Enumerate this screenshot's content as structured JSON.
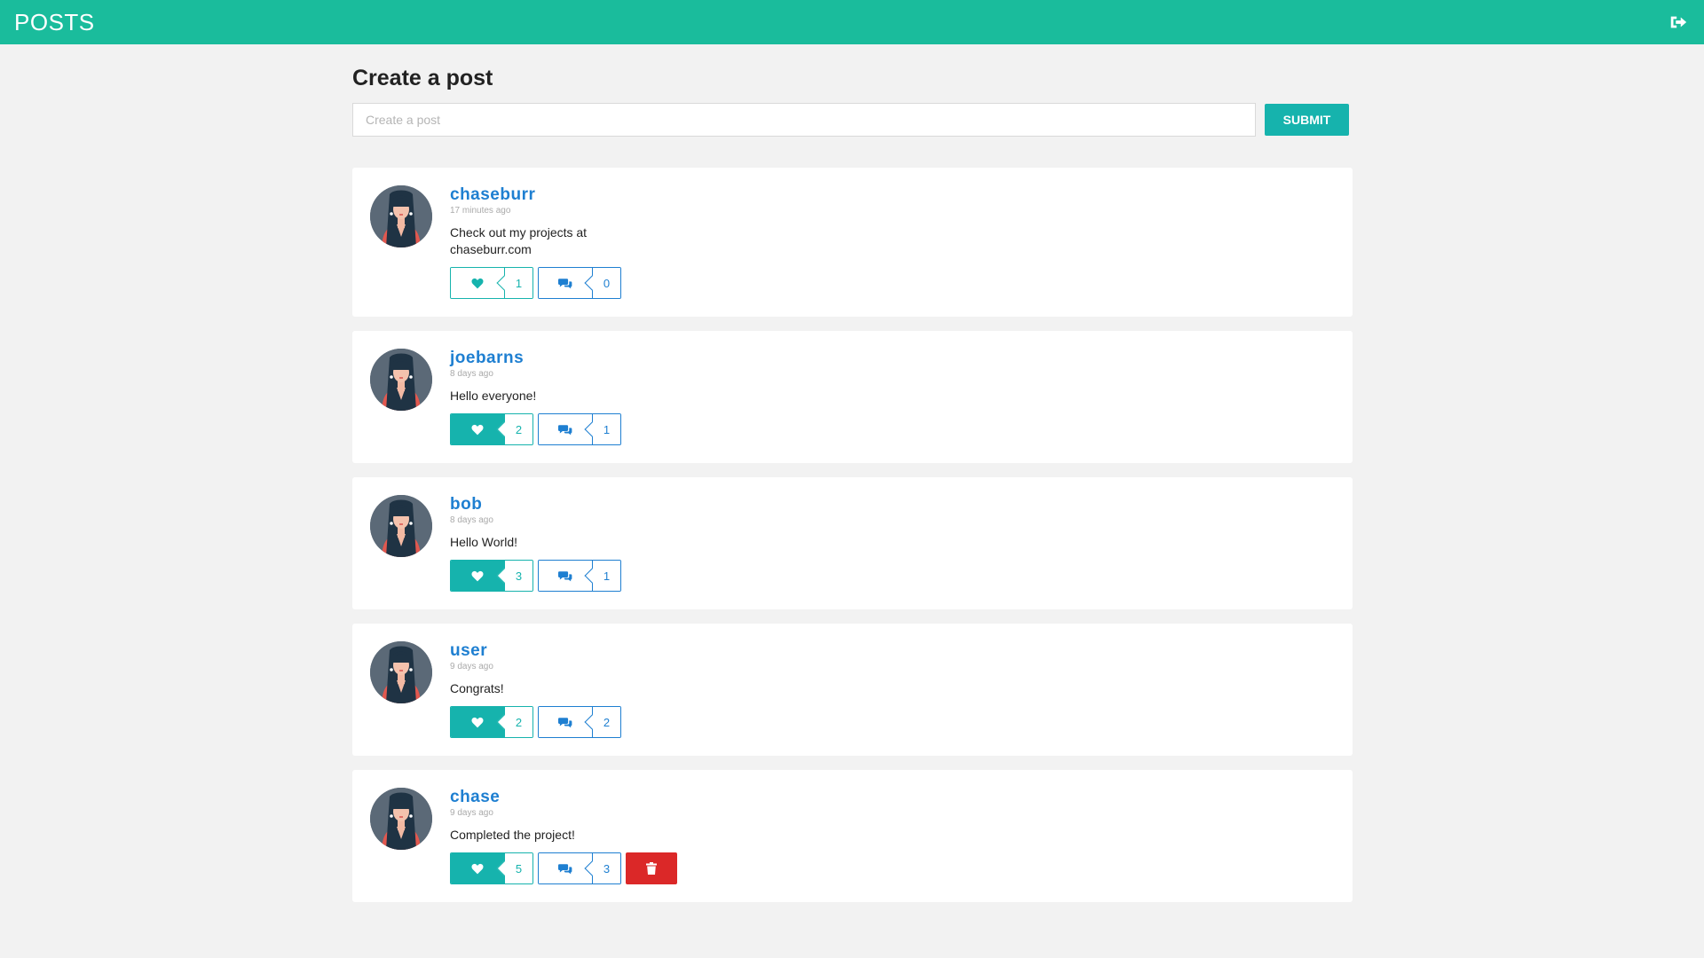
{
  "header": {
    "title": "POSTS",
    "logout_icon": "sign-out-icon"
  },
  "composer": {
    "title": "Create a post",
    "placeholder": "Create a post",
    "value": "",
    "submit_label": "SUBMIT"
  },
  "colors": {
    "header": "#1abc9c",
    "accent": "#16b3ad",
    "link": "#1e7fd1",
    "danger": "#db2828"
  },
  "posts": [
    {
      "username": "chaseburr",
      "time": "17 minutes ago",
      "content": "Check out my projects at chaseburr.com",
      "likes": "1",
      "comments": "0",
      "liked": false,
      "deletable": false
    },
    {
      "username": "joebarns",
      "time": "8 days ago",
      "content": "Hello everyone!",
      "likes": "2",
      "comments": "1",
      "liked": true,
      "deletable": false
    },
    {
      "username": "bob",
      "time": "8 days ago",
      "content": "Hello World!",
      "likes": "3",
      "comments": "1",
      "liked": true,
      "deletable": false
    },
    {
      "username": "user",
      "time": "9 days ago",
      "content": "Congrats!",
      "likes": "2",
      "comments": "2",
      "liked": true,
      "deletable": false
    },
    {
      "username": "chase",
      "time": "9 days ago",
      "content": "Completed the project!",
      "likes": "5",
      "comments": "3",
      "liked": true,
      "deletable": true
    }
  ]
}
